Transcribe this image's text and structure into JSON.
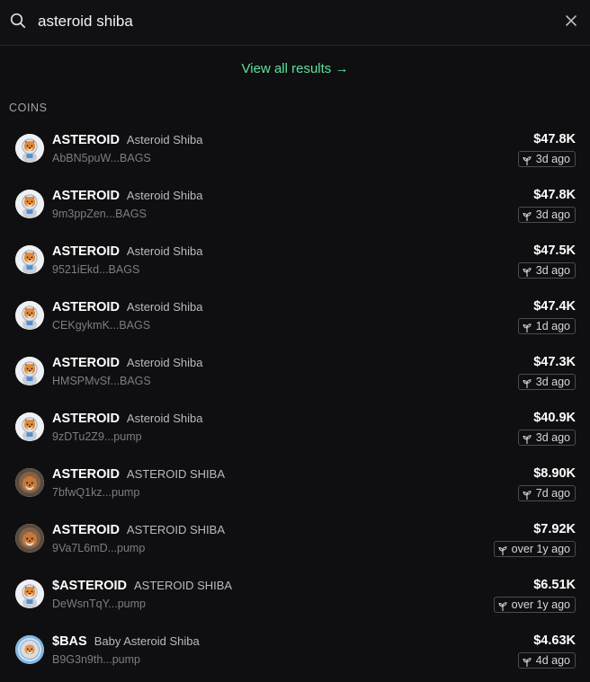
{
  "search": {
    "value": "asteroid shiba",
    "icon": "search-icon"
  },
  "view_all_label": "View all results →",
  "section_title": "COINS",
  "colors": {
    "accent": "#5fe0a0",
    "background": "#0f0f11"
  },
  "results": [
    {
      "ticker": "ASTEROID",
      "name": "Asteroid Shiba",
      "address": "AbBN5puW...BAGS",
      "market_cap": "$47.8K",
      "age": "3d ago",
      "avatar": "astronaut-shiba"
    },
    {
      "ticker": "ASTEROID",
      "name": "Asteroid Shiba",
      "address": "9m3ppZen...BAGS",
      "market_cap": "$47.8K",
      "age": "3d ago",
      "avatar": "astronaut-shiba"
    },
    {
      "ticker": "ASTEROID",
      "name": "Asteroid Shiba",
      "address": "9521iEkd...BAGS",
      "market_cap": "$47.5K",
      "age": "3d ago",
      "avatar": "astronaut-shiba"
    },
    {
      "ticker": "ASTEROID",
      "name": "Asteroid Shiba",
      "address": "CEKgykmK...BAGS",
      "market_cap": "$47.4K",
      "age": "1d ago",
      "avatar": "astronaut-shiba"
    },
    {
      "ticker": "ASTEROID",
      "name": "Asteroid Shiba",
      "address": "HMSPMvSf...BAGS",
      "market_cap": "$47.3K",
      "age": "3d ago",
      "avatar": "astronaut-shiba"
    },
    {
      "ticker": "ASTEROID",
      "name": "Asteroid Shiba",
      "address": "9zDTu2Z9...pump",
      "market_cap": "$40.9K",
      "age": "3d ago",
      "avatar": "astronaut-shiba"
    },
    {
      "ticker": "ASTEROID",
      "name": "ASTEROID SHIBA",
      "address": "7bfwQ1kz...pump",
      "market_cap": "$8.90K",
      "age": "7d ago",
      "avatar": "shiba-photo"
    },
    {
      "ticker": "ASTEROID",
      "name": "ASTEROID SHIBA",
      "address": "9Va7L6mD...pump",
      "market_cap": "$7.92K",
      "age": "over 1y ago",
      "avatar": "shiba-photo"
    },
    {
      "ticker": "$ASTEROID",
      "name": "ASTEROID SHIBA",
      "address": "DeWsnTqY...pump",
      "market_cap": "$6.51K",
      "age": "over 1y ago",
      "avatar": "astronaut-shiba"
    },
    {
      "ticker": "$BAS",
      "name": "Baby Asteroid Shiba",
      "address": "B9G3n9th...pump",
      "market_cap": "$4.63K",
      "age": "4d ago",
      "avatar": "baby-shiba"
    }
  ]
}
